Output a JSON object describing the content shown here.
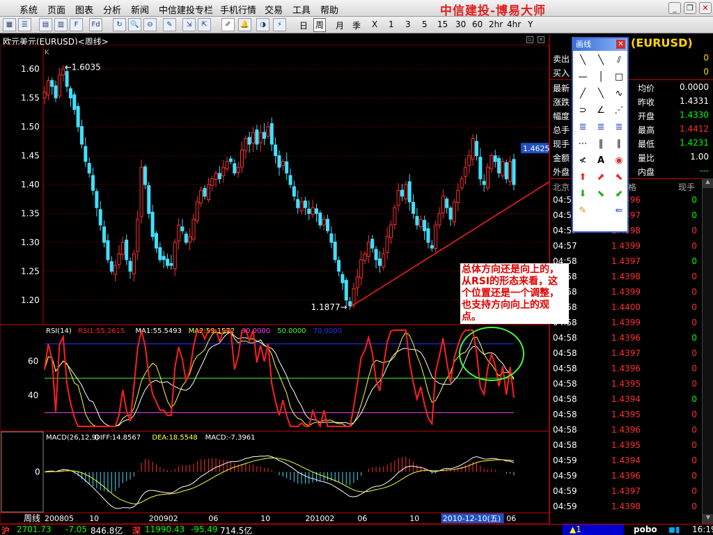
{
  "app": {
    "brand": "中信建投-博易大师"
  },
  "menu": [
    "系统",
    "页面",
    "图表",
    "分析",
    "新闻",
    "中信建投专栏",
    "手机行情",
    "交易",
    "工具",
    "帮助"
  ],
  "toolbar": {
    "periods": [
      "日",
      "周",
      "月",
      "季",
      "X",
      "1",
      "3",
      "5",
      "15",
      "30",
      "60",
      "2hr",
      "4hr",
      "Y"
    ],
    "active_period": "周"
  },
  "chart_title": "欧元美元(EURUSD)<周线>",
  "k_label": "K",
  "chart_data": [
    {
      "type": "candlestick",
      "title": "欧元美元(EURUSD)<周线>",
      "ylim": [
        1.16,
        1.64
      ],
      "yticks": [
        "1.60",
        "1.55",
        "1.50",
        "1.45",
        "1.40",
        "1.35",
        "1.30",
        "1.25",
        "1.20"
      ],
      "annotations": [
        {
          "text": "1.6035",
          "value": 1.6035
        },
        {
          "text": "1.1877",
          "value": 1.1877
        }
      ],
      "last_price_label": "1.4625",
      "close": [
        1.56,
        1.58,
        1.57,
        1.55,
        1.59,
        1.6,
        1.57,
        1.55,
        1.53,
        1.5,
        1.47,
        1.44,
        1.42,
        1.39,
        1.36,
        1.33,
        1.3,
        1.27,
        1.25,
        1.26,
        1.28,
        1.3,
        1.27,
        1.25,
        1.28,
        1.34,
        1.43,
        1.4,
        1.35,
        1.31,
        1.29,
        1.27,
        1.27,
        1.26,
        1.26,
        1.3,
        1.33,
        1.32,
        1.3,
        1.31,
        1.34,
        1.37,
        1.39,
        1.38,
        1.4,
        1.41,
        1.42,
        1.41,
        1.43,
        1.44,
        1.44,
        1.42,
        1.43,
        1.46,
        1.48,
        1.47,
        1.49,
        1.47,
        1.49,
        1.48,
        1.5,
        1.47,
        1.45,
        1.43,
        1.44,
        1.42,
        1.4,
        1.38,
        1.36,
        1.37,
        1.36,
        1.35,
        1.36,
        1.35,
        1.33,
        1.34,
        1.32,
        1.3,
        1.27,
        1.25,
        1.23,
        1.2,
        1.19,
        1.22,
        1.24,
        1.27,
        1.28,
        1.3,
        1.29,
        1.27,
        1.26,
        1.28,
        1.31,
        1.33,
        1.36,
        1.39,
        1.38,
        1.4,
        1.37,
        1.35,
        1.33,
        1.34,
        1.32,
        1.3,
        1.29,
        1.33,
        1.35,
        1.38,
        1.36,
        1.34,
        1.37,
        1.39,
        1.41,
        1.43,
        1.45,
        1.48,
        1.45,
        1.41,
        1.4,
        1.43,
        1.45,
        1.44,
        1.42,
        1.44,
        1.41,
        1.44,
        1.4
      ]
    },
    {
      "type": "line",
      "title": "RSI(14)",
      "legend": [
        {
          "name": "RSI1",
          "value": "55.2615",
          "color": "#ff2020"
        },
        {
          "name": "MA1",
          "value": "55.5493",
          "color": "#ffffff"
        },
        {
          "name": "MA2",
          "value": "59.1572",
          "color": "#ffff40"
        },
        {
          "name": "30.0000",
          "color": "#ff40ff"
        },
        {
          "name": "50.0000",
          "color": "#40ff40"
        },
        {
          "name": "70.0000",
          "color": "#3030ff"
        }
      ],
      "yticks": [
        "60",
        "40"
      ],
      "ylim": [
        20,
        80
      ],
      "levels": [
        30,
        50,
        70
      ]
    },
    {
      "type": "bar",
      "title": "MACD(26,12,9)",
      "legend": [
        {
          "name": "DIFF",
          "value": "14.8567",
          "color": "#ffffff"
        },
        {
          "name": "DEA",
          "value": "18.5548",
          "color": "#ffff40"
        },
        {
          "name": "MACD",
          "value": "-7.3961",
          "color": "#ffffff"
        }
      ],
      "yticks": [
        "0"
      ]
    }
  ],
  "xaxis": {
    "label": "周线",
    "ticks": [
      "200805",
      "10",
      "200902",
      "06",
      "10",
      "201002",
      "06",
      "10",
      "06"
    ],
    "cursor": "2010-12-10(五)"
  },
  "quote": {
    "title": "(EURUSD)",
    "sell_label": "卖出",
    "sell": "0",
    "buy_label": "买入",
    "buy": "0",
    "left": [
      {
        "l": "最新",
        "v": ""
      },
      {
        "l": "涨跌",
        "v": ""
      },
      {
        "l": "幅度",
        "v": ""
      },
      {
        "l": "总手",
        "v": ""
      },
      {
        "l": "现手",
        "v": ""
      },
      {
        "l": "金额",
        "v": ""
      },
      {
        "l": "外盘",
        "v": ""
      }
    ],
    "right": [
      {
        "l": "均价",
        "v": "0.0000",
        "c": "#ffffff"
      },
      {
        "l": "昨收",
        "v": "1.4331",
        "c": "#ffffff"
      },
      {
        "l": "开盘",
        "v": "1.4330",
        "c": "#00ff00"
      },
      {
        "l": "最高",
        "v": "1.4412",
        "c": "#ff3030"
      },
      {
        "l": "最低",
        "v": "1.4231",
        "c": "#00ff00"
      },
      {
        "l": "量比",
        "v": "1.00",
        "c": "#ffffff"
      },
      {
        "l": "内盘",
        "v": "---",
        "c": "#00ff00"
      }
    ]
  },
  "ticks_header": {
    "time": "北京",
    "price": "格",
    "volume": "现手"
  },
  "ticks": [
    [
      "04:57",
      "1.4396",
      "0"
    ],
    [
      "04:57",
      "1.4397",
      "0"
    ],
    [
      "04:57",
      "1.4398",
      "0"
    ],
    [
      "04:57",
      "1.4399",
      "0"
    ],
    [
      "04:58",
      "1.4397",
      "0"
    ],
    [
      "04:58",
      "1.4398",
      "0"
    ],
    [
      "04:58",
      "1.4399",
      "0"
    ],
    [
      "04:58",
      "1.4400",
      "0"
    ],
    [
      "04:58",
      "1.4399",
      "0"
    ],
    [
      "04:58",
      "1.4396",
      "0"
    ],
    [
      "04:58",
      "1.4397",
      "0"
    ],
    [
      "04:58",
      "1.4396",
      "0"
    ],
    [
      "04:58",
      "1.4395",
      "0"
    ],
    [
      "04:58",
      "1.4394",
      "0"
    ],
    [
      "04:58",
      "1.4395",
      "0"
    ],
    [
      "04:58",
      "1.4396",
      "0"
    ],
    [
      "04:58",
      "1.4395",
      "0"
    ],
    [
      "04:59",
      "1.4394",
      "0"
    ],
    [
      "04:59",
      "1.4396",
      "0"
    ],
    [
      "04:59",
      "1.4397",
      "0"
    ],
    [
      "04:59",
      "1.4398",
      "0"
    ]
  ],
  "tick_volume_green": [
    true,
    true,
    false,
    false,
    true,
    false,
    false,
    false,
    false,
    true,
    false,
    false,
    false,
    true,
    false,
    false,
    false,
    false,
    false,
    false,
    false
  ],
  "drawtools": {
    "title": "画线"
  },
  "annotation": "总体方向还是向上的，从RSI的形态来看，这个位置还是一个调整，也支持方向向上的观点。",
  "status": {
    "sh_label": "沪",
    "sh_price": "2701.73",
    "sh_chg": "-7.05",
    "sh_amt": "846.8亿",
    "sz_label": "深",
    "sz_price": "11990.43",
    "sz_chg": "-95.49",
    "sz_amt": "714.5亿",
    "alerts": "▲1",
    "pobo": "pobo",
    "time": "16:19"
  }
}
